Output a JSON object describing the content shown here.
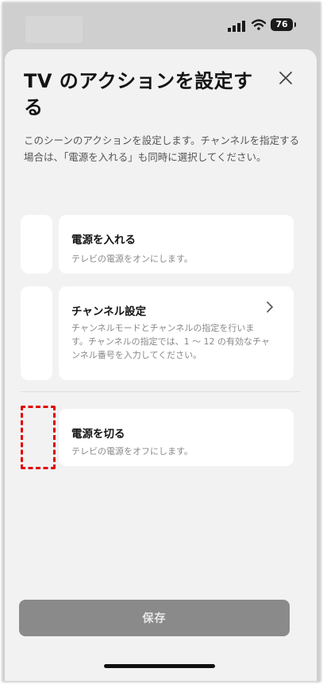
{
  "status_bar": {
    "battery": "76"
  },
  "sheet": {
    "title": "TV のアクションを設定する",
    "description": "このシーンのアクションを設定します。チャンネルを指定する場合は、「電源を入れる」も同時に選択してください。"
  },
  "actions": [
    {
      "title": "電源を入れる",
      "description": "テレビの電源をオンにします。"
    },
    {
      "title": "チャンネル設定",
      "description": "チャンネルモードとチャンネルの指定を行います。チャンネルの指定では、1 〜 12 の有効なチャンネル番号を入力してください。"
    },
    {
      "title": "電源を切る",
      "description": "テレビの電源をオフにします。"
    }
  ],
  "footer": {
    "save_label": "保存"
  },
  "colors": {
    "sheet_background": "#f2f2f2",
    "save_button": "#8a8a8a",
    "highlight": "#e00000"
  },
  "icons": [
    "signal-icon",
    "wifi-icon",
    "battery-icon",
    "close-icon",
    "chevron-right-icon"
  ]
}
